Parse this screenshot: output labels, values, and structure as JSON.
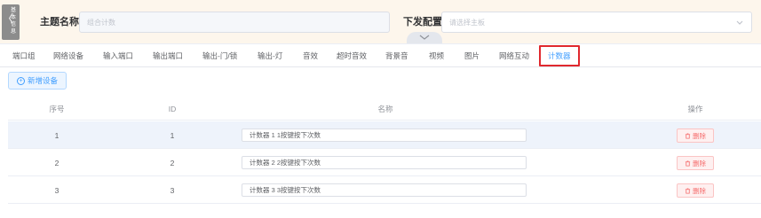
{
  "sidebar_tab": {
    "label": "基本信息"
  },
  "header": {
    "theme_label": "主题名称",
    "theme_placeholder": "组合计数",
    "config_label": "下发配置",
    "config_placeholder": "请选择主板"
  },
  "tabs": [
    {
      "label": "端口组"
    },
    {
      "label": "网络设备"
    },
    {
      "label": "输入端口"
    },
    {
      "label": "输出端口"
    },
    {
      "label": "输出-门/锁"
    },
    {
      "label": "输出-灯"
    },
    {
      "label": "音效"
    },
    {
      "label": "超时音效"
    },
    {
      "label": "背景音"
    },
    {
      "label": "视频"
    },
    {
      "label": "图片"
    },
    {
      "label": "网络互动"
    },
    {
      "label": "计数器"
    }
  ],
  "active_tab": "计数器",
  "toolbar": {
    "add_label": "新增设备"
  },
  "table": {
    "columns": [
      "序号",
      "ID",
      "名称",
      "操作"
    ],
    "rows": [
      {
        "index": "1",
        "id": "1",
        "name": "计数器 1 1按键按下次数",
        "action": "删除"
      },
      {
        "index": "2",
        "id": "2",
        "name": "计数器 2 2按键按下次数",
        "action": "删除"
      },
      {
        "index": "3",
        "id": "3",
        "name": "计数器 3 3按键按下次数",
        "action": "删除"
      }
    ]
  },
  "colors": {
    "accent": "#409eff",
    "danger": "#f56c6c",
    "highlight_border": "#e0282e",
    "header_bg": "#fdf6ec",
    "row_highlight": "#eef3fb"
  }
}
